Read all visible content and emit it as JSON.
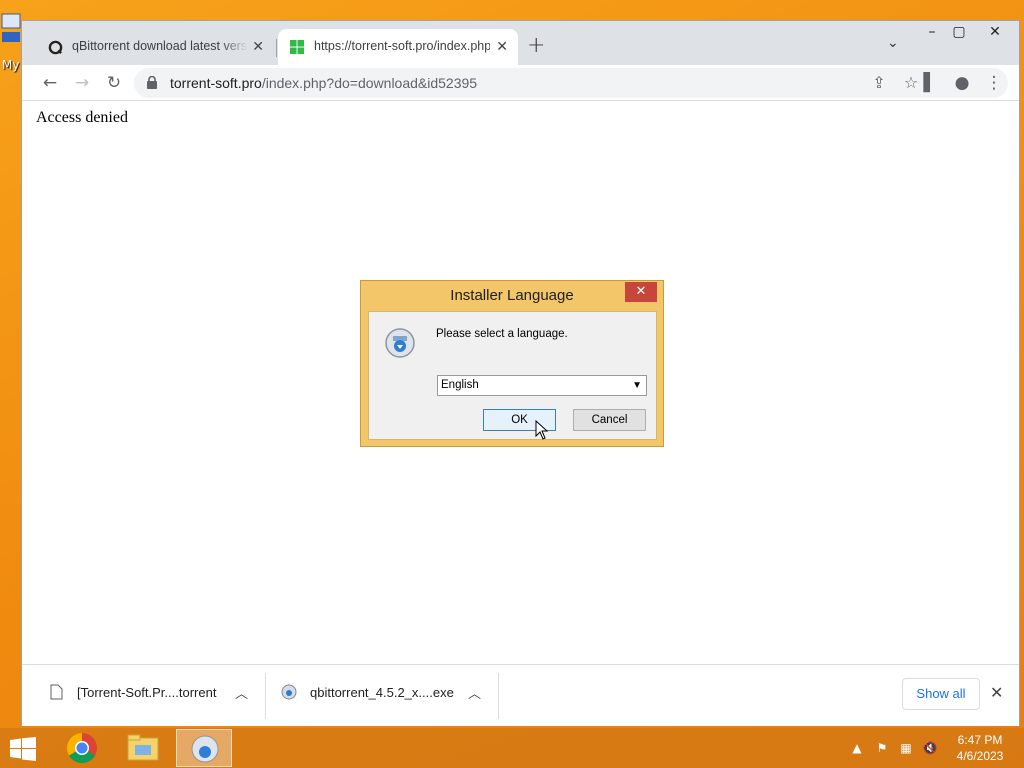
{
  "desktop": {
    "icon_label": "My"
  },
  "browser": {
    "tabs": [
      {
        "title": "qBittorrent download latest versi",
        "favicon": "qbittorrent-icon",
        "active": false
      },
      {
        "title": "https://torrent-soft.pro/index.php",
        "favicon": "windows-logo-icon",
        "active": true
      }
    ],
    "new_tab_symbol": "+",
    "address": {
      "host": "torrent-soft.pro",
      "path": "/index.php?do=download&id52395"
    },
    "page_text": "Access denied"
  },
  "downloads": {
    "items": [
      {
        "name": "[Torrent-Soft.Pr....torrent",
        "icon": "file-icon"
      },
      {
        "name": "qbittorrent_4.5.2_x....exe",
        "icon": "installer-icon"
      }
    ],
    "show_all_label": "Show all"
  },
  "dialog": {
    "title": "Installer Language",
    "message": "Please select a language.",
    "selected_language": "English",
    "ok_label": "OK",
    "cancel_label": "Cancel"
  },
  "taskbar": {
    "time": "6:47 PM",
    "date": "4/6/2023"
  },
  "colors": {
    "desktop_background": "#f08a0f",
    "dialog_frame": "#f3c66a",
    "link_blue": "#1a73e8",
    "close_red": "#c7453b"
  }
}
